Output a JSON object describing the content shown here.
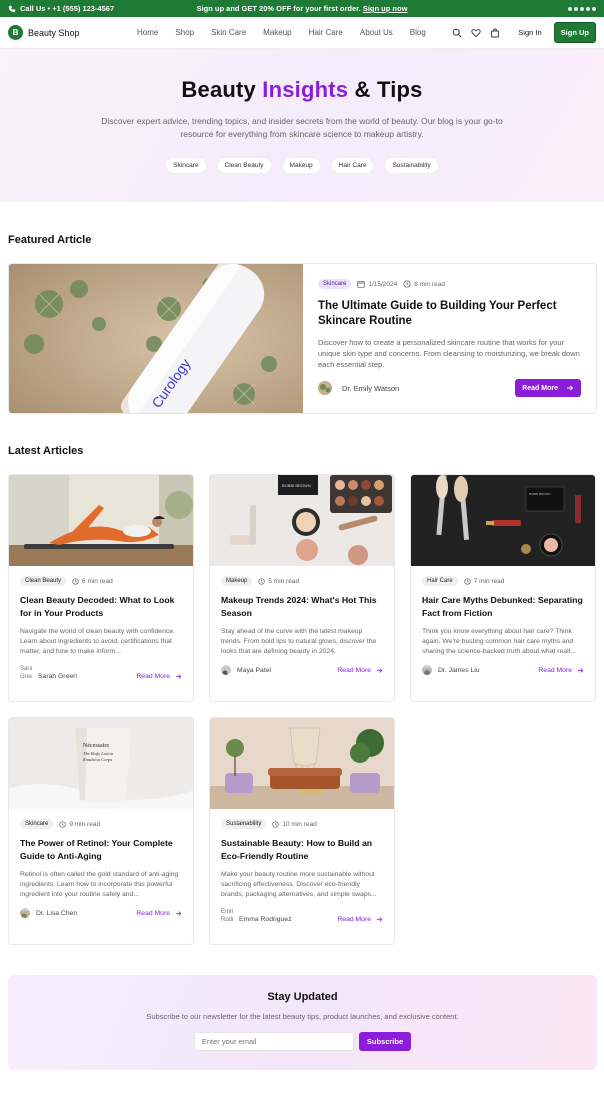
{
  "topbar": {
    "phone": "Call Us • +1 (555) 123-4567",
    "promo": "Sign up and GET 20% OFF for your first order.",
    "promo_link": "Sign up now"
  },
  "nav": {
    "brand": "Beauty Shop",
    "brand_initial": "B",
    "links": [
      "Home",
      "Shop",
      "Skin Care",
      "Makeup",
      "Hair Care",
      "About Us",
      "Blog"
    ],
    "signin": "Sign In",
    "signup": "Sign Up"
  },
  "hero": {
    "title_pre": "Beauty ",
    "title_accent": "Insights",
    "title_post": " & Tips",
    "subtitle": "Discover expert advice, trending topics, and insider secrets from the world of beauty. Our blog is your go-to resource for everything from skincare science to makeup artistry.",
    "tags": [
      "Skincare",
      "Clean Beauty",
      "Makeup",
      "Hair Care",
      "Sustainability"
    ]
  },
  "featured": {
    "section_title": "Featured Article",
    "category": "Skincare",
    "date": "1/15/2024",
    "read_time": "8 min read",
    "title": "The Ultimate Guide to Building Your Perfect Skincare Routine",
    "excerpt": "Discover how to create a personalized skincare routine that works for your unique skin type and concerns. From cleansing to moisturizing, we break down each essential step.",
    "author": "Dr. Emily Watson",
    "button": "Read More",
    "image_text": "Curology"
  },
  "latest": {
    "section_title": "Latest Articles",
    "read_more": "Read More",
    "articles": [
      {
        "category": "Clean Beauty",
        "read_time": "6 min read",
        "title": "Clean Beauty Decoded: What to Look for in Your Products",
        "excerpt": "Navigate the world of clean beauty with confidence. Learn about ingredients to avoid, certifications that matter, and how to make inform...",
        "author": "Sarah Green",
        "avatar_alt": "Sarah Green"
      },
      {
        "category": "Makeup",
        "read_time": "5 min read",
        "title": "Makeup Trends 2024: What's Hot This Season",
        "excerpt": "Stay ahead of the curve with the latest makeup trends. From bold lips to natural glows, discover the looks that are defining beauty in 2024.",
        "author": "Maya Patel"
      },
      {
        "category": "Hair Care",
        "read_time": "7 min read",
        "title": "Hair Care Myths Debunked: Separating Fact from Fiction",
        "excerpt": "Think you know everything about hair care? Think again. We're busting common hair care myths and sharing the science-backed truth about what realt...",
        "author": "Dr. James Liu"
      },
      {
        "category": "Skincare",
        "read_time": "9 min read",
        "title": "The Power of Retinol: Your Complete Guide to Anti-Aging",
        "excerpt": "Retinol is often called the gold standard of anti-aging ingredients. Learn how to incorporate this powerful ingredient into your routine safely and...",
        "author": "Dr. Lisa Chen"
      },
      {
        "category": "Sustainability",
        "read_time": "10 min read",
        "title": "Sustainable Beauty: How to Build an Eco-Friendly Routine",
        "excerpt": "Make your beauty routine more sustainable without sacrificing effectiveness. Discover eco-friendly brands, packaging alternatives, and simple swaps...",
        "author": "Emma Rodriguez",
        "avatar_alt": "Emma Rodriguez"
      }
    ]
  },
  "newsletter": {
    "title": "Stay Updated",
    "subtitle": "Subscribe to our newsletter for the latest beauty tips, product launches, and exclusive content.",
    "placeholder": "Enter your email",
    "button": "Subscribe"
  },
  "image_text": {
    "tube_brand": "Nécessaire",
    "tube_product": "The Body Lotion",
    "tube_sub": "Emulsion Corps",
    "palette_brand": "BOBBI BROWN"
  },
  "colors": {
    "brand_green": "#1e7a34",
    "accent_purple": "#8b1fd9"
  }
}
